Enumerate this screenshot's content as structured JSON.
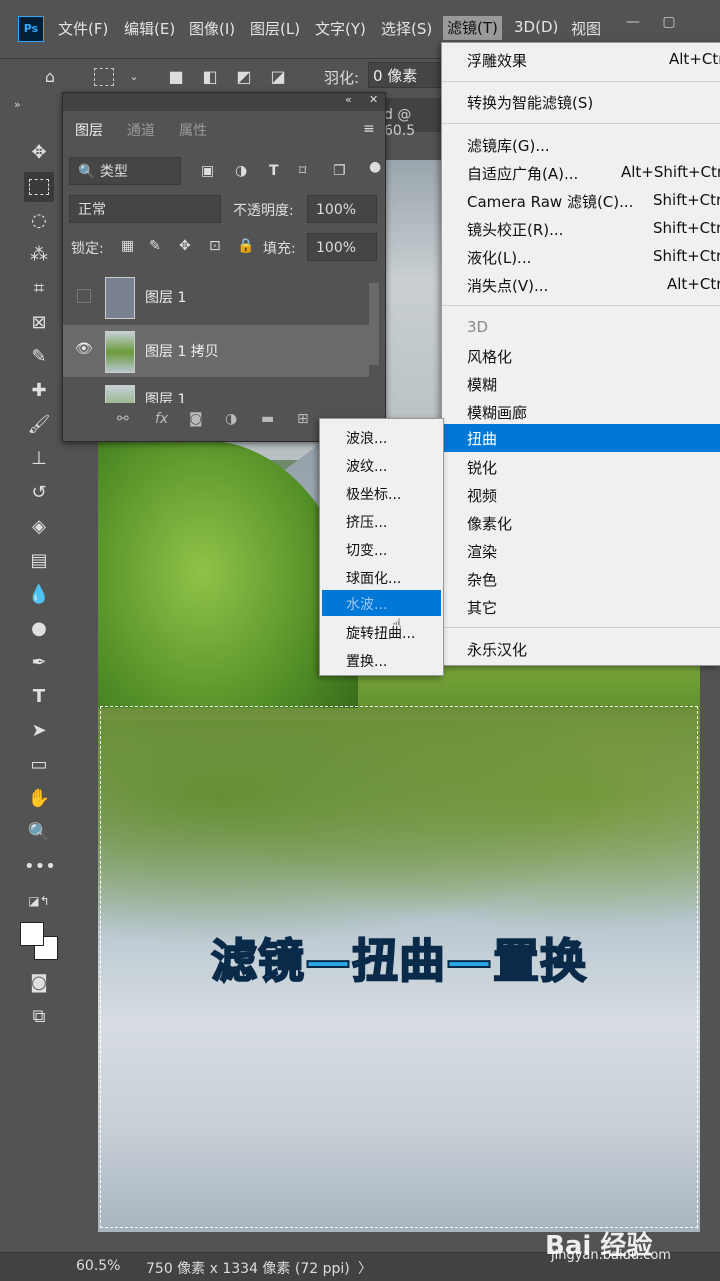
{
  "menubar": {
    "logo": "Ps",
    "items": [
      "文件(F)",
      "编辑(E)",
      "图像(I)",
      "图层(L)",
      "文字(Y)",
      "选择(S)",
      "滤镜(T)",
      "3D(D)",
      "视图"
    ],
    "window_buttons": [
      "—",
      "▢"
    ]
  },
  "optionsbar": {
    "feather_label": "羽化:",
    "feather_value": "0 像素"
  },
  "doc_tab": "d @ 60.5",
  "layers_panel": {
    "tabs": [
      "图层",
      "通道",
      "属性"
    ],
    "filter_label": "类型",
    "blend_mode": "正常",
    "opacity_label": "不透明度:",
    "opacity_value": "100%",
    "lock_label": "锁定:",
    "fill_label": "填充:",
    "fill_value": "100%",
    "layers": [
      {
        "name": "图层 1"
      },
      {
        "name": "图层 1 拷贝"
      },
      {
        "name": "图层 1"
      }
    ]
  },
  "filter_menu": {
    "items": [
      {
        "label": "浮雕效果",
        "shortcut": "Alt+Ctr"
      },
      {
        "label": "转换为智能滤镜(S)",
        "shortcut": ""
      },
      {
        "label": "滤镜库(G)...",
        "shortcut": ""
      },
      {
        "label": "自适应广角(A)...",
        "shortcut": "Alt+Shift+Ctr"
      },
      {
        "label": "Camera Raw 滤镜(C)...",
        "shortcut": "Shift+Ctr"
      },
      {
        "label": "镜头校正(R)...",
        "shortcut": "Shift+Ctr"
      },
      {
        "label": "液化(L)...",
        "shortcut": "Shift+Ctr"
      },
      {
        "label": "消失点(V)...",
        "shortcut": "Alt+Ctr"
      },
      {
        "label": "3D",
        "shortcut": ""
      },
      {
        "label": "风格化",
        "shortcut": ""
      },
      {
        "label": "模糊",
        "shortcut": ""
      },
      {
        "label": "模糊画廊",
        "shortcut": ""
      },
      {
        "label": "扭曲",
        "shortcut": ""
      },
      {
        "label": "锐化",
        "shortcut": ""
      },
      {
        "label": "视频",
        "shortcut": ""
      },
      {
        "label": "像素化",
        "shortcut": ""
      },
      {
        "label": "渲染",
        "shortcut": ""
      },
      {
        "label": "杂色",
        "shortcut": ""
      },
      {
        "label": "其它",
        "shortcut": ""
      },
      {
        "label": "永乐汉化",
        "shortcut": ""
      }
    ]
  },
  "distort_submenu": {
    "items": [
      "波浪...",
      "波纹...",
      "极坐标...",
      "挤压...",
      "切变...",
      "球面化...",
      "水波...",
      "旋转扭曲...",
      "置换..."
    ]
  },
  "canvas_caption": "滤镜—扭曲—置换",
  "status": {
    "zoom": "60.5%",
    "doc_info": "750 像素 x 1334 像素 (72 ppi)",
    "arrow": "〉"
  },
  "watermark": {
    "main": "Bai 经验",
    "sub": "jingyan.baidu.com"
  },
  "colors": {
    "accent": "#0078d7",
    "ui_bg": "#535353",
    "caption": "#2aa8e6"
  }
}
